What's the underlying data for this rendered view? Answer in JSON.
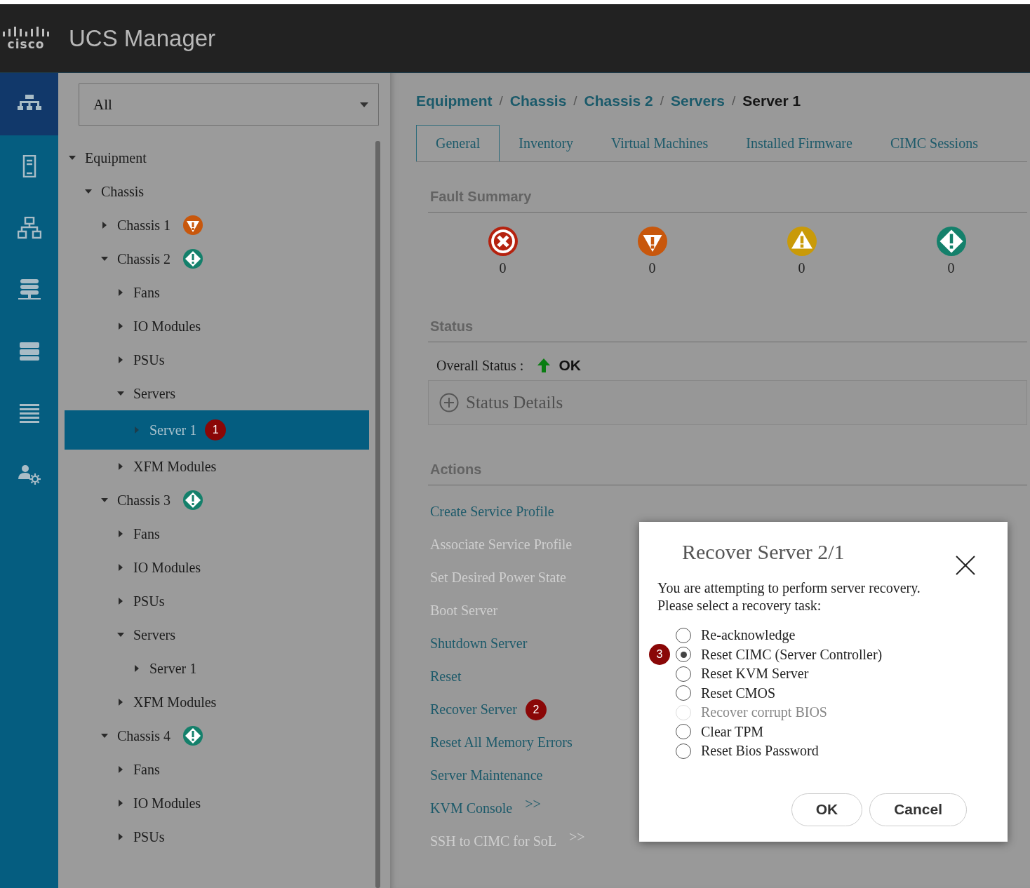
{
  "header": {
    "logo_text": "cisco",
    "title": "UCS Manager"
  },
  "rail": [
    {
      "kind": "hierarchy",
      "selected": true
    },
    {
      "kind": "server",
      "selected": false
    },
    {
      "kind": "network",
      "selected": false
    },
    {
      "kind": "san",
      "selected": false
    },
    {
      "kind": "storage",
      "selected": false
    },
    {
      "kind": "list",
      "selected": false
    },
    {
      "kind": "admin",
      "selected": false
    }
  ],
  "filter": {
    "value": "All"
  },
  "tree": [
    {
      "label": "Equipment",
      "expanded": true,
      "selected": false,
      "children": [
        {
          "label": "Chassis",
          "expanded": true,
          "selected": false,
          "children": [
            {
              "label": "Chassis 1",
              "expanded": false,
              "selected": false,
              "fault": {
                "kind": "major"
              }
            },
            {
              "label": "Chassis 2",
              "expanded": true,
              "selected": false,
              "fault": {
                "kind": "info"
              },
              "children": [
                {
                  "label": "Fans",
                  "expanded": false,
                  "selected": false
                },
                {
                  "label": "IO Modules",
                  "expanded": false,
                  "selected": false
                },
                {
                  "label": "PSUs",
                  "expanded": false,
                  "selected": false
                },
                {
                  "label": "Servers",
                  "expanded": true,
                  "selected": false,
                  "children": [
                    {
                      "label": "Server 1",
                      "expanded": false,
                      "selected": true,
                      "callout": "1"
                    }
                  ]
                },
                {
                  "label": "XFM Modules",
                  "expanded": false,
                  "selected": false
                }
              ]
            },
            {
              "label": "Chassis 3",
              "expanded": true,
              "selected": false,
              "fault": {
                "kind": "info"
              },
              "children": [
                {
                  "label": "Fans",
                  "expanded": false,
                  "selected": false
                },
                {
                  "label": "IO Modules",
                  "expanded": false,
                  "selected": false
                },
                {
                  "label": "PSUs",
                  "expanded": false,
                  "selected": false
                },
                {
                  "label": "Servers",
                  "expanded": true,
                  "selected": false,
                  "children": [
                    {
                      "label": "Server 1",
                      "expanded": false,
                      "selected": false
                    }
                  ]
                },
                {
                  "label": "XFM Modules",
                  "expanded": false,
                  "selected": false
                }
              ]
            },
            {
              "label": "Chassis 4",
              "expanded": true,
              "selected": false,
              "fault": {
                "kind": "info"
              },
              "children": [
                {
                  "label": "Fans",
                  "expanded": false,
                  "selected": false
                },
                {
                  "label": "IO Modules",
                  "expanded": false,
                  "selected": false
                },
                {
                  "label": "PSUs",
                  "expanded": false,
                  "selected": false
                }
              ]
            }
          ]
        }
      ]
    }
  ],
  "breadcrumb": [
    {
      "label": "Equipment",
      "current": false
    },
    {
      "separator": "/",
      "label": "Chassis",
      "current": false
    },
    {
      "separator": "/",
      "label": "Chassis 2",
      "current": false
    },
    {
      "separator": "/",
      "label": "Servers",
      "current": false
    },
    {
      "separator": "/",
      "label": "Server 1",
      "current": true
    }
  ],
  "tabs": [
    {
      "label": "General",
      "selected": true
    },
    {
      "label": "Inventory",
      "selected": false
    },
    {
      "label": "Virtual Machines",
      "selected": false
    },
    {
      "label": "Installed Firmware",
      "selected": false
    },
    {
      "label": "CIMC Sessions",
      "selected": false
    }
  ],
  "fault_summary": {
    "title": "Fault Summary",
    "items": [
      {
        "kind": "critical",
        "count": "0"
      },
      {
        "kind": "major",
        "count": "0"
      },
      {
        "kind": "minor",
        "count": "0"
      },
      {
        "kind": "info",
        "count": "0"
      }
    ]
  },
  "status": {
    "title": "Status",
    "label": "Overall Status :",
    "value": "OK",
    "details": "Status Details"
  },
  "actions": {
    "title": "Actions",
    "items": [
      {
        "label": "Create Service Profile",
        "disabled": false
      },
      {
        "label": "Associate Service Profile",
        "disabled": true
      },
      {
        "label": "Set Desired Power State",
        "disabled": true
      },
      {
        "label": "Boot Server",
        "disabled": true
      },
      {
        "label": "Shutdown Server",
        "disabled": false
      },
      {
        "label": "Reset",
        "disabled": false
      },
      {
        "label": "Recover Server",
        "disabled": false,
        "callout": "2"
      },
      {
        "label": "Reset All Memory Errors",
        "disabled": false
      },
      {
        "label": "Server Maintenance",
        "disabled": false
      },
      {
        "label": "KVM Console",
        "disabled": false,
        "more": ">>"
      },
      {
        "label": "SSH to CIMC for SoL",
        "disabled": true,
        "more": ">>"
      }
    ]
  },
  "dialog": {
    "title": "Recover Server 2/1",
    "message": [
      "You are attempting to perform server recovery.",
      "Please select a recovery task:"
    ],
    "options": [
      {
        "label": "Re-acknowledge",
        "selected": false,
        "disabled": false
      },
      {
        "label": "Reset CIMC (Server Controller)",
        "selected": true,
        "disabled": false,
        "callout": "3"
      },
      {
        "label": "Reset KVM Server",
        "selected": false,
        "disabled": false
      },
      {
        "label": "Reset CMOS",
        "selected": false,
        "disabled": false
      },
      {
        "label": "Recover corrupt BIOS",
        "selected": false,
        "disabled": true
      },
      {
        "label": "Clear TPM",
        "selected": false,
        "disabled": false
      },
      {
        "label": "Reset Bios Password",
        "selected": false,
        "disabled": false
      }
    ],
    "buttons": [
      {
        "label": "OK"
      },
      {
        "label": "Cancel"
      }
    ]
  }
}
